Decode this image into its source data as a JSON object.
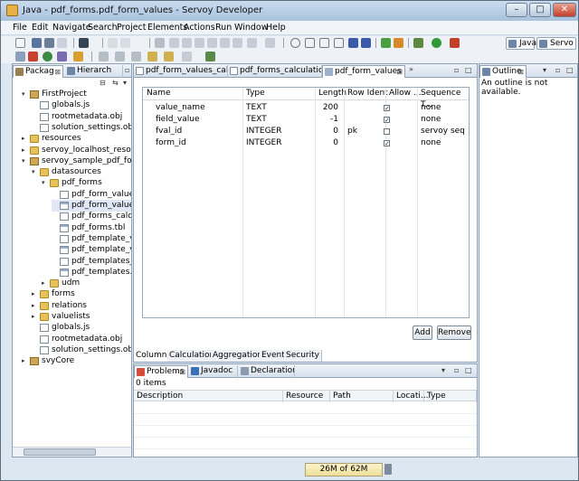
{
  "window": {
    "title": "Java - pdf_forms.pdf_form_values - Servoy Developer"
  },
  "menu": [
    "File",
    "Edit",
    "Navigate",
    "Search",
    "Project",
    "Elements",
    "Actions",
    "Run",
    "Window",
    "Help"
  ],
  "perspectives": {
    "java": "Java",
    "servoy": "Servo"
  },
  "left_pane": {
    "tabs": [
      "Packag",
      "Hierarch"
    ],
    "tree": [
      {
        "label": "FirstProject",
        "indent": 0,
        "twisty": "▾",
        "icon": "proj"
      },
      {
        "label": "globals.js",
        "indent": 1,
        "twisty": "",
        "icon": "file"
      },
      {
        "label": "rootmetadata.obj",
        "indent": 1,
        "twisty": "",
        "icon": "file"
      },
      {
        "label": "solution_settings.obj",
        "indent": 1,
        "twisty": "",
        "icon": "file"
      },
      {
        "label": "resources",
        "indent": 0,
        "twisty": "▸",
        "icon": "folder"
      },
      {
        "label": "servoy_localhost_resources",
        "indent": 0,
        "twisty": "▸",
        "icon": "folder"
      },
      {
        "label": "servoy_sample_pdf_forms",
        "indent": 0,
        "twisty": "▾",
        "icon": "proj"
      },
      {
        "label": "datasources",
        "indent": 1,
        "twisty": "▾",
        "icon": "folder"
      },
      {
        "label": "pdf_forms",
        "indent": 2,
        "twisty": "▾",
        "icon": "folder"
      },
      {
        "label": "pdf_form_values_calc",
        "indent": 3,
        "twisty": "",
        "icon": "file"
      },
      {
        "label": "pdf_form_values.tbl",
        "indent": 3,
        "twisty": "",
        "icon": "tbl",
        "selected": true
      },
      {
        "label": "pdf_forms_calculatio",
        "indent": 3,
        "twisty": "",
        "icon": "file"
      },
      {
        "label": "pdf_forms.tbl",
        "indent": 3,
        "twisty": "",
        "icon": "tbl"
      },
      {
        "label": "pdf_template_values",
        "indent": 3,
        "twisty": "",
        "icon": "file"
      },
      {
        "label": "pdf_template_values",
        "indent": 3,
        "twisty": "",
        "icon": "tbl"
      },
      {
        "label": "pdf_templates_calcu",
        "indent": 3,
        "twisty": "",
        "icon": "file"
      },
      {
        "label": "pdf_templates.tbl",
        "indent": 3,
        "twisty": "",
        "icon": "tbl"
      },
      {
        "label": "udm",
        "indent": 2,
        "twisty": "▸",
        "icon": "folder"
      },
      {
        "label": "forms",
        "indent": 1,
        "twisty": "▸",
        "icon": "folder"
      },
      {
        "label": "relations",
        "indent": 1,
        "twisty": "▸",
        "icon": "folder"
      },
      {
        "label": "valuelists",
        "indent": 1,
        "twisty": "▸",
        "icon": "folder"
      },
      {
        "label": "globals.js",
        "indent": 1,
        "twisty": "",
        "icon": "file"
      },
      {
        "label": "rootmetadata.obj",
        "indent": 1,
        "twisty": "",
        "icon": "file"
      },
      {
        "label": "solution_settings.obj",
        "indent": 1,
        "twisty": "",
        "icon": "file"
      },
      {
        "label": "svyCore",
        "indent": 0,
        "twisty": "▸",
        "icon": "proj"
      }
    ]
  },
  "editor": {
    "tabs": [
      "pdf_form_values_calc",
      "pdf_forms_calculatio",
      "pdf_form_values"
    ],
    "overflow": "»",
    "columns": [
      "Name",
      "Type",
      "Length",
      "Row Ident",
      "Allow ...",
      "Sequence T..."
    ],
    "rows": [
      {
        "name": "value_name",
        "type": "TEXT",
        "length": "200",
        "row_ident": "",
        "allow": true,
        "sequence": "none"
      },
      {
        "name": "field_value",
        "type": "TEXT",
        "length": "-1",
        "row_ident": "",
        "allow": true,
        "sequence": "none"
      },
      {
        "name": "fval_id",
        "type": "INTEGER",
        "length": "0",
        "row_ident": "pk",
        "allow": false,
        "sequence": "servoy seq"
      },
      {
        "name": "form_id",
        "type": "INTEGER",
        "length": "0",
        "row_ident": "",
        "allow": true,
        "sequence": "none"
      }
    ],
    "buttons": {
      "add": "Add",
      "remove": "Remove"
    },
    "subtabs": [
      "Columns",
      "Calculations",
      "Aggregations",
      "Events",
      "Security"
    ]
  },
  "outline": {
    "tab": "Outline",
    "message": "An outline is not available."
  },
  "problems": {
    "tabs": [
      "Problems",
      "Javadoc",
      "Declaration"
    ],
    "count": "0 items",
    "columns": [
      "Description",
      "Resource",
      "Path",
      "Locati...",
      "Type"
    ]
  },
  "status": {
    "heap": "26M of 62M"
  }
}
